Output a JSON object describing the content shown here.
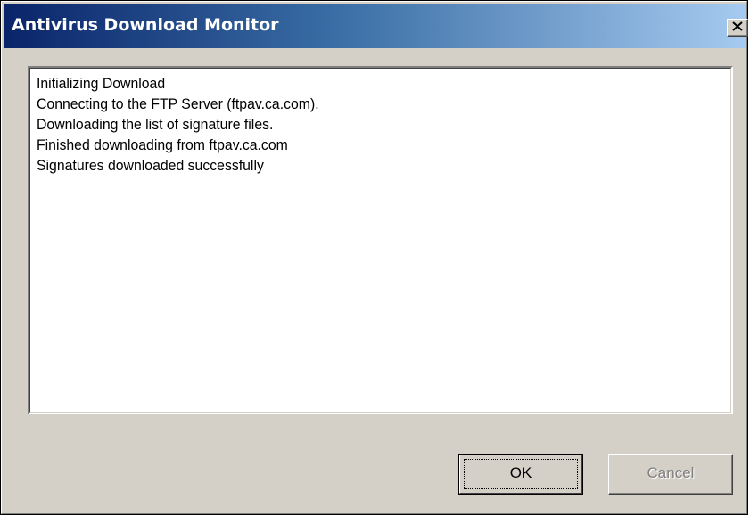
{
  "window": {
    "title": "Antivirus Download Monitor",
    "close_glyph": "✕",
    "close_icon": "close-icon"
  },
  "log": {
    "lines": [
      "Initializing Download",
      "Connecting to the FTP Server (ftpav.ca.com).",
      "Downloading the list of signature files.",
      "Finished downloading from ftpav.ca.com",
      "Signatures downloaded successfully"
    ]
  },
  "buttons": {
    "ok_label": "OK",
    "cancel_label": "Cancel",
    "cancel_enabled": false
  },
  "colors": {
    "title_gradient_start": "#0a246a",
    "title_gradient_end": "#a6caf0",
    "face": "#d4d0c8",
    "disabled_text": "#808080"
  }
}
